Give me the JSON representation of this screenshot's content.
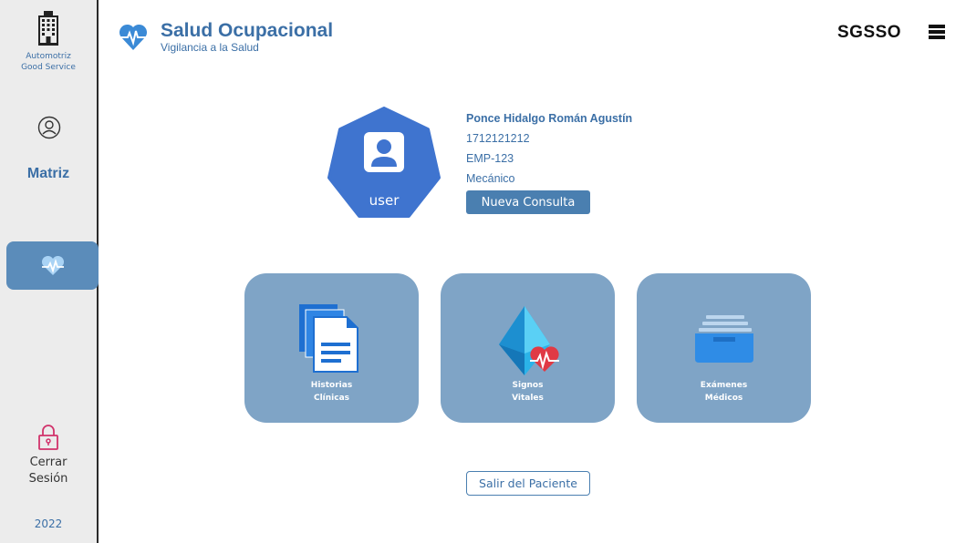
{
  "sidebar": {
    "company_line1": "Automotriz",
    "company_line2": "Good Service",
    "matriz_label": "Matriz",
    "logout_line1": "Cerrar",
    "logout_line2": "Sesión",
    "year": "2022"
  },
  "header": {
    "title": "Salud Ocupacional",
    "subtitle": "Vigilancia a la Salud",
    "system_name": "SGSSO"
  },
  "patient": {
    "avatar_label": "user",
    "name": "Ponce Hidalgo Román Agustín",
    "id_number": "1712121212",
    "employee_code": "EMP-123",
    "position": "Mecánico",
    "new_consult_label": "Nueva Consulta"
  },
  "cards": [
    {
      "line1": "Historias",
      "line2": "Clínicas"
    },
    {
      "line1": "Signos",
      "line2": "Vitales"
    },
    {
      "line1": "Exámenes",
      "line2": "Médicos"
    }
  ],
  "exit_patient_label": "Salir del Paciente",
  "colors": {
    "brand_blue": "#3b6fa6",
    "card_bg": "#7fa4c6",
    "sidebar_bg": "#ececec",
    "active_nav": "#5b8cba",
    "logout_pink": "#d1336b"
  }
}
